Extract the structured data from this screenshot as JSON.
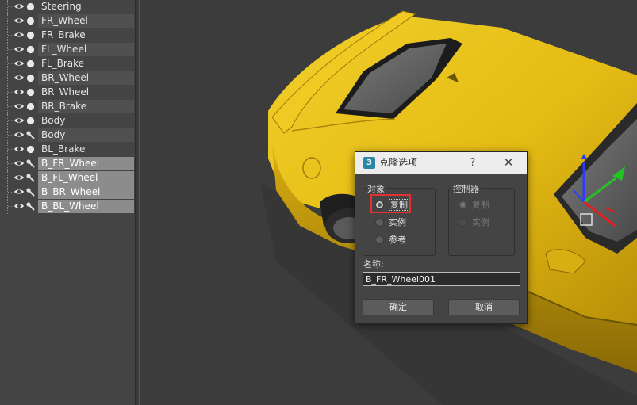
{
  "explorer": {
    "items": [
      {
        "name": "Steering",
        "type": "sphere",
        "style": "normal"
      },
      {
        "name": "FR_Wheel",
        "type": "sphere",
        "style": "alt"
      },
      {
        "name": "FR_Brake",
        "type": "sphere",
        "style": "normal"
      },
      {
        "name": "FL_Wheel",
        "type": "sphere",
        "style": "alt"
      },
      {
        "name": "FL_Brake",
        "type": "sphere",
        "style": "normal"
      },
      {
        "name": "BR_Wheel",
        "type": "sphere",
        "style": "alt"
      },
      {
        "name": "BR_Wheel",
        "type": "sphere",
        "style": "normal"
      },
      {
        "name": "BR_Brake",
        "type": "sphere",
        "style": "alt"
      },
      {
        "name": "Body",
        "type": "sphere",
        "style": "normal"
      },
      {
        "name": "Body",
        "type": "wrench",
        "style": "alt"
      },
      {
        "name": "BL_Brake",
        "type": "sphere",
        "style": "normal"
      },
      {
        "name": "B_FR_Wheel",
        "type": "wrench",
        "style": "sel"
      },
      {
        "name": "B_FL_Wheel",
        "type": "wrench",
        "style": "sel"
      },
      {
        "name": "B_BR_Wheel",
        "type": "wrench",
        "style": "sel"
      },
      {
        "name": "B_BL_Wheel",
        "type": "wrench",
        "style": "sel"
      }
    ]
  },
  "dialog": {
    "app_icon": "3",
    "title": "克隆选项",
    "help": "?",
    "close": "✕",
    "object_group": {
      "label": "对象",
      "options": [
        {
          "label": "复制",
          "checked": true
        },
        {
          "label": "实例",
          "checked": false
        },
        {
          "label": "参考",
          "checked": false
        }
      ]
    },
    "controller_group": {
      "label": "控制器",
      "options": [
        {
          "label": "复制",
          "checked": true
        },
        {
          "label": "实例",
          "checked": false
        }
      ]
    },
    "name_label": "名称:",
    "name_value": "B_FR_Wheel001",
    "ok_label": "确定",
    "cancel_label": "取消"
  },
  "colors": {
    "accent_highlight": "#e53030",
    "car_body": "#e8c21a",
    "selection": "#8c8c8c"
  }
}
